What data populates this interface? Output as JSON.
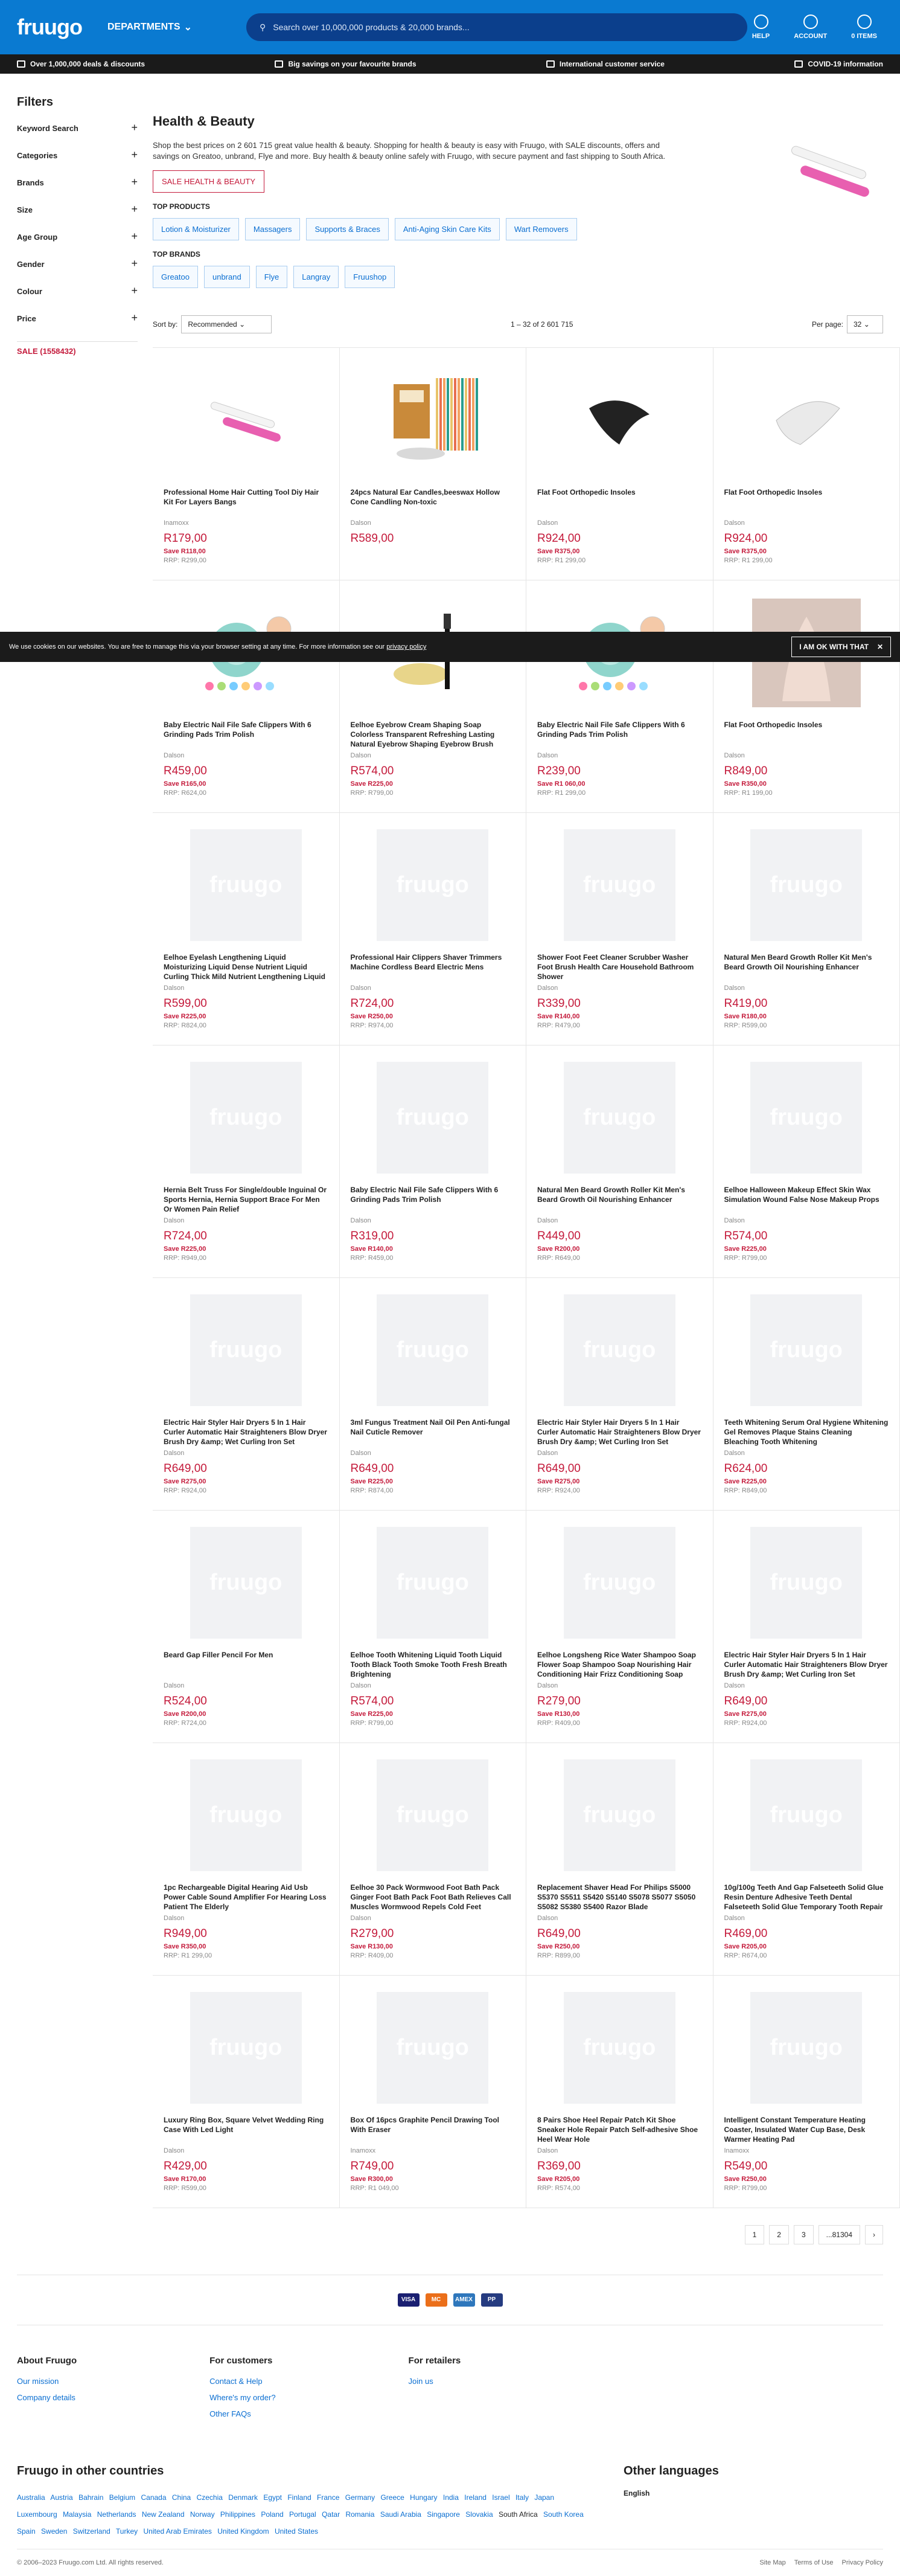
{
  "header": {
    "logo": "fruugo",
    "departments": "DEPARTMENTS",
    "search_placeholder": "Search over 10,000,000 products & 20,000 brands...",
    "help": "HELP",
    "account": "ACCOUNT",
    "items": "0 ITEMS"
  },
  "strip": [
    "Over 1,000,000 deals & discounts",
    "Big savings on your favourite brands",
    "International customer service",
    "COVID-19 information"
  ],
  "filters": {
    "title": "Filters",
    "items": [
      "Keyword Search",
      "Categories",
      "Brands",
      "Size",
      "Age Group",
      "Gender",
      "Colour",
      "Price"
    ],
    "sale": "SALE (1558432)"
  },
  "page": {
    "title": "Health & Beauty",
    "desc": "Shop the best prices on 2 601 715 great value health & beauty. Shopping for health & beauty is easy with Fruugo, with SALE discounts, offers and savings on Greatoo, unbrand, Flye and more. Buy health & beauty online safely with Fruugo, with secure payment and fast shipping to South Africa.",
    "sale_button": "SALE HEALTH & BEAUTY",
    "top_products": "TOP PRODUCTS",
    "products_chips": [
      "Lotion & Moisturizer",
      "Massagers",
      "Supports & Braces",
      "Anti-Aging Skin Care Kits",
      "Wart Removers"
    ],
    "top_brands": "TOP BRANDS",
    "brand_chips": [
      "Greatoo",
      "unbrand",
      "Flye",
      "Langray",
      "Fruushop"
    ],
    "sort_label": "Sort by:",
    "sort_value": "Recommended",
    "count": "1 – 32 of 2 601 715",
    "per_page_label": "Per page:",
    "per_page": "32"
  },
  "cookie": {
    "text": "We use cookies on our websites. You are free to manage this via your browser setting at any time. For more information see our",
    "link": "privacy policy",
    "button": "I AM OK WITH THAT"
  },
  "products": [
    {
      "t": "Professional Home Hair Cutting Tool Diy Hair Kit For Layers Bangs",
      "b": "Inamoxx",
      "p": "R179,00",
      "s": "Save R118,00",
      "r": "RRP: R299,00",
      "img": "comb"
    },
    {
      "t": "24pcs Natural Ear Candles,beeswax Hollow Cone Candling Non-toxic",
      "b": "Dalson",
      "p": "R589,00",
      "s": "",
      "r": "",
      "img": "candle"
    },
    {
      "t": "Flat Foot Orthopedic Insoles",
      "b": "Dalson",
      "p": "R924,00",
      "s": "Save R375,00",
      "r": "RRP: R1 299,00",
      "img": "insole-black"
    },
    {
      "t": "Flat Foot Orthopedic Insoles",
      "b": "Dalson",
      "p": "R924,00",
      "s": "Save R375,00",
      "r": "RRP: R1 299,00",
      "img": "insole-white"
    },
    {
      "t": "Baby Electric Nail File Safe Clippers With 6 Grinding Pads Trim Polish",
      "b": "Dalson",
      "p": "R459,00",
      "s": "Save R165,00",
      "r": "RRP: R624,00",
      "img": "nailfile"
    },
    {
      "t": "Eelhoe Eyebrow Cream Shaping Soap Colorless Transparent Refreshing Lasting Natural Eyebrow Shaping Eyebrow Brush",
      "b": "Dalson",
      "p": "R574,00",
      "s": "Save R225,00",
      "r": "RRP: R799,00",
      "img": "brow"
    },
    {
      "t": "Baby Electric Nail File Safe Clippers With 6 Grinding Pads Trim Polish",
      "b": "Dalson",
      "p": "R239,00",
      "s": "Save R1 060,00",
      "r": "RRP: R1 299,00",
      "img": "nailfile"
    },
    {
      "t": "Flat Foot Orthopedic Insoles",
      "b": "Dalson",
      "p": "R849,00",
      "s": "Save R350,00",
      "r": "RRP: R1 199,00",
      "img": "foot"
    },
    {
      "t": "Eelhoe Eyelash Lengthening Liquid Moisturizing Liquid Dense Nutrient Liquid Curling Thick Mild Nutrient Lengthening Liquid",
      "b": "Dalson",
      "p": "R599,00",
      "s": "Save R225,00",
      "r": "RRP: R824,00",
      "img": ""
    },
    {
      "t": "Professional Hair Clippers Shaver Trimmers Machine Cordless Beard Electric Mens",
      "b": "Dalson",
      "p": "R724,00",
      "s": "Save R250,00",
      "r": "RRP: R974,00",
      "img": ""
    },
    {
      "t": "Shower Foot Feet Cleaner Scrubber Washer Foot Brush Health Care Household Bathroom Shower",
      "b": "Dalson",
      "p": "R339,00",
      "s": "Save R140,00",
      "r": "RRP: R479,00",
      "img": ""
    },
    {
      "t": "Natural Men Beard Growth Roller Kit Men's Beard Growth Oil Nourishing Enhancer",
      "b": "Dalson",
      "p": "R419,00",
      "s": "Save R180,00",
      "r": "RRP: R599,00",
      "img": ""
    },
    {
      "t": "Hernia Belt Truss For Single/double Inguinal Or Sports Hernia, Hernia Support Brace For Men Or Women Pain Relief",
      "b": "Dalson",
      "p": "R724,00",
      "s": "Save R225,00",
      "r": "RRP: R949,00",
      "img": ""
    },
    {
      "t": "Baby Electric Nail File Safe Clippers With 6 Grinding Pads Trim Polish",
      "b": "Dalson",
      "p": "R319,00",
      "s": "Save R140,00",
      "r": "RRP: R459,00",
      "img": ""
    },
    {
      "t": "Natural Men Beard Growth Roller Kit Men's Beard Growth Oil Nourishing Enhancer",
      "b": "Dalson",
      "p": "R449,00",
      "s": "Save R200,00",
      "r": "RRP: R649,00",
      "img": ""
    },
    {
      "t": "Eelhoe Halloween Makeup Effect Skin Wax Simulation Wound False Nose Makeup Props",
      "b": "Dalson",
      "p": "R574,00",
      "s": "Save R225,00",
      "r": "RRP: R799,00",
      "img": ""
    },
    {
      "t": "Electric Hair Styler Hair Dryers 5 In 1 Hair Curler Automatic Hair Straighteners Blow Dryer Brush Dry &amp; Wet Curling Iron Set",
      "b": "Dalson",
      "p": "R649,00",
      "s": "Save R275,00",
      "r": "RRP: R924,00",
      "img": ""
    },
    {
      "t": "3ml Fungus Treatment Nail Oil Pen Anti-fungal Nail Cuticle Remover",
      "b": "Dalson",
      "p": "R649,00",
      "s": "Save R225,00",
      "r": "RRP: R874,00",
      "img": ""
    },
    {
      "t": "Electric Hair Styler Hair Dryers 5 In 1 Hair Curler Automatic Hair Straighteners Blow Dryer Brush Dry &amp; Wet Curling Iron Set",
      "b": "Dalson",
      "p": "R649,00",
      "s": "Save R275,00",
      "r": "RRP: R924,00",
      "img": ""
    },
    {
      "t": "Teeth Whitening Serum Oral Hygiene Whitening Gel Removes Plaque Stains Cleaning Bleaching Tooth Whitening",
      "b": "Dalson",
      "p": "R624,00",
      "s": "Save R225,00",
      "r": "RRP: R849,00",
      "img": ""
    },
    {
      "t": "Beard Gap Filler Pencil For Men",
      "b": "Dalson",
      "p": "R524,00",
      "s": "Save R200,00",
      "r": "RRP: R724,00",
      "img": ""
    },
    {
      "t": "Eelhoe Tooth Whitening Liquid Tooth Liquid Tooth Black Tooth Smoke Tooth Fresh Breath Brightening",
      "b": "Dalson",
      "p": "R574,00",
      "s": "Save R225,00",
      "r": "RRP: R799,00",
      "img": ""
    },
    {
      "t": "Eelhoe Longsheng Rice Water Shampoo Soap Flower Soap Shampoo Soap Nourishing Hair Conditioning Hair Frizz Conditioning Soap",
      "b": "Dalson",
      "p": "R279,00",
      "s": "Save R130,00",
      "r": "RRP: R409,00",
      "img": ""
    },
    {
      "t": "Electric Hair Styler Hair Dryers 5 In 1 Hair Curler Automatic Hair Straighteners Blow Dryer Brush Dry &amp; Wet Curling Iron Set",
      "b": "Dalson",
      "p": "R649,00",
      "s": "Save R275,00",
      "r": "RRP: R924,00",
      "img": ""
    },
    {
      "t": "1pc Rechargeable Digital Hearing Aid Usb Power Cable Sound Amplifier For Hearing Loss Patient The Elderly",
      "b": "Dalson",
      "p": "R949,00",
      "s": "Save R350,00",
      "r": "RRP: R1 299,00",
      "img": ""
    },
    {
      "t": "Eelhoe 30 Pack Wormwood Foot Bath Pack Ginger Foot Bath Pack Foot Bath Relieves Call Muscles Wormwood Repels Cold Feet",
      "b": "Dalson",
      "p": "R279,00",
      "s": "Save R130,00",
      "r": "RRP: R409,00",
      "img": ""
    },
    {
      "t": "Replacement Shaver Head For Philips S5000 S5370 S5511 S5420 S5140 S5078 S5077 S5050 S5082 S5380 S5400 Razor Blade",
      "b": "Dalson",
      "p": "R649,00",
      "s": "Save R250,00",
      "r": "RRP: R899,00",
      "img": ""
    },
    {
      "t": "10g/100g Teeth And Gap Falseteeth Solid Glue Resin Denture Adhesive Teeth Dental Falseteeth Solid Glue Temporary Tooth Repair Set",
      "b": "Dalson",
      "p": "R469,00",
      "s": "Save R205,00",
      "r": "RRP: R674,00",
      "img": ""
    },
    {
      "t": "Luxury Ring Box, Square Velvet Wedding Ring Case With Led Light",
      "b": "Dalson",
      "p": "R429,00",
      "s": "Save R170,00",
      "r": "RRP: R599,00",
      "img": ""
    },
    {
      "t": "Box Of 16pcs Graphite Pencil Drawing Tool With Eraser",
      "b": "Inamoxx",
      "p": "R749,00",
      "s": "Save R300,00",
      "r": "RRP: R1 049,00",
      "img": ""
    },
    {
      "t": "8 Pairs Shoe Heel Repair Patch Kit Shoe Sneaker Hole Repair Patch Self-adhesive Shoe Heel Wear Hole",
      "b": "Dalson",
      "p": "R369,00",
      "s": "Save R205,00",
      "r": "RRP: R574,00",
      "img": ""
    },
    {
      "t": "Intelligent Constant Temperature Heating Coaster, Insulated Water Cup Base, Desk Warmer Heating Pad",
      "b": "Inamoxx",
      "p": "R549,00",
      "s": "Save R250,00",
      "r": "RRP: R799,00",
      "img": ""
    }
  ],
  "pagination": [
    "1",
    "2",
    "3",
    "...81304",
    "›"
  ],
  "payments": [
    "VISA",
    "MC",
    "AMEX",
    "PP"
  ],
  "footer": {
    "about": {
      "title": "About Fruugo",
      "links": [
        "Our mission",
        "Company details"
      ]
    },
    "customers": {
      "title": "For customers",
      "links": [
        "Contact & Help",
        "Where's my order?",
        "Other FAQs"
      ]
    },
    "retailers": {
      "title": "For retailers",
      "links": [
        "Join us"
      ]
    }
  },
  "countries": {
    "title": "Fruugo in other countries",
    "list": [
      "Australia",
      "Austria",
      "Bahrain",
      "Belgium",
      "Canada",
      "China",
      "Czechia",
      "Denmark",
      "Egypt",
      "Finland",
      "France",
      "Germany",
      "Greece",
      "Hungary",
      "India",
      "Ireland",
      "Israel",
      "Italy",
      "Japan",
      "Luxembourg",
      "Malaysia",
      "Netherlands",
      "New Zealand",
      "Norway",
      "Philippines",
      "Poland",
      "Portugal",
      "Qatar",
      "Romania",
      "Saudi Arabia",
      "Singapore",
      "Slovakia",
      "South Africa",
      "South Korea",
      "Spain",
      "Sweden",
      "Switzerland",
      "Turkey",
      "United Arab Emirates",
      "United Kingdom",
      "United States"
    ],
    "current": "South Africa",
    "lang_title": "Other languages",
    "lang": "English"
  },
  "bottom": {
    "copy": "© 2006–2023 Fruugo.com Ltd. All rights reserved.",
    "links": [
      "Site Map",
      "Terms of Use",
      "Privacy Policy"
    ]
  }
}
